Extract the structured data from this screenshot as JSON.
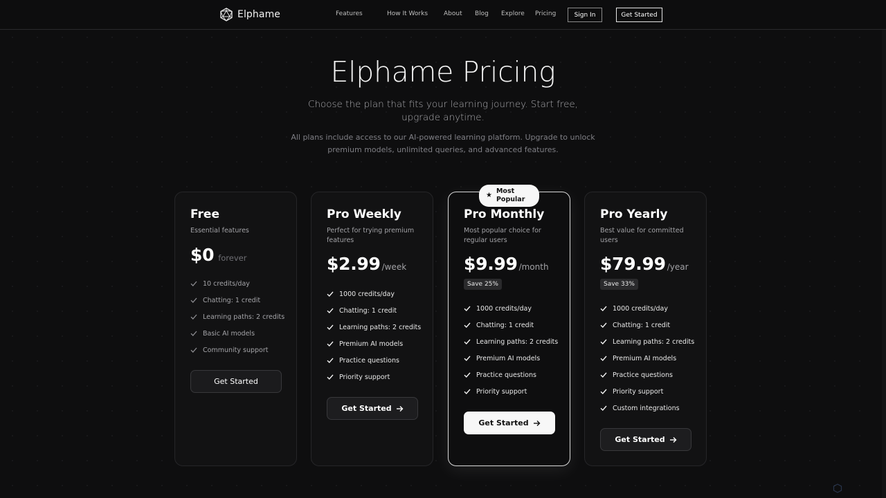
{
  "nav": {
    "brand": "Elphame",
    "links": [
      "Features",
      "How It Works",
      "About",
      "Blog",
      "Explore",
      "Pricing"
    ],
    "sign_in": "Sign In",
    "get_started": "Get Started"
  },
  "hero": {
    "title": "Elphame Pricing",
    "subtitle": "Choose the plan that fits your learning journey. Start free, upgrade anytime.",
    "note": "All plans include access to our AI-powered learning platform. Upgrade to unlock premium models, unlimited queries, and advanced features."
  },
  "popular_badge": "Most Popular",
  "plans": [
    {
      "name": "Free",
      "description": "Essential features",
      "price": "$0",
      "period": "forever",
      "save": "",
      "features": [
        "10 credits/day",
        "Chatting: 1 credit",
        "Learning paths: 2 credits",
        "Basic AI models",
        "Community support"
      ],
      "cta": "Get Started"
    },
    {
      "name": "Pro Weekly",
      "description": "Perfect for trying premium features",
      "price": "$2.99",
      "period": "/week",
      "save": "",
      "features": [
        "1000 credits/day",
        "Chatting: 1 credit",
        "Learning paths: 2 credits",
        "Premium AI models",
        "Practice questions",
        "Priority support"
      ],
      "cta": "Get Started"
    },
    {
      "name": "Pro Monthly",
      "description": "Most popular choice for regular users",
      "price": "$9.99",
      "period": "/month",
      "save": "Save 25%",
      "features": [
        "1000 credits/day",
        "Chatting: 1 credit",
        "Learning paths: 2 credits",
        "Premium AI models",
        "Practice questions",
        "Priority support"
      ],
      "cta": "Get Started"
    },
    {
      "name": "Pro Yearly",
      "description": "Best value for committed users",
      "price": "$79.99",
      "period": "/year",
      "save": "Save 33%",
      "features": [
        "1000 credits/day",
        "Chatting: 1 credit",
        "Learning paths: 2 credits",
        "Premium AI models",
        "Practice questions",
        "Priority support",
        "Custom integrations"
      ],
      "cta": "Get Started"
    }
  ],
  "colors": {
    "background": "#0e0e0f",
    "card": "#121213",
    "card_border": "#262628",
    "featured_border": "#d9d9d9",
    "text_muted": "#a2a2a6"
  }
}
